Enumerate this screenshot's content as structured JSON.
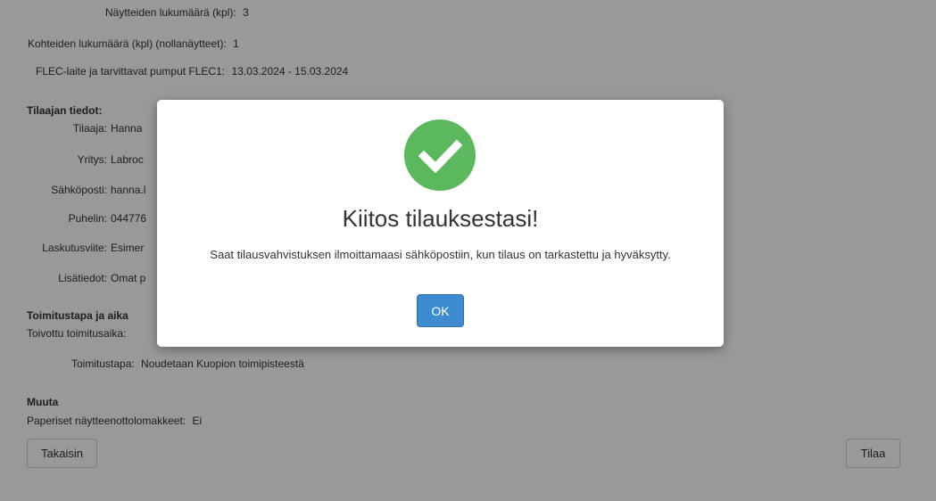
{
  "form": {
    "samples": {
      "label": "Näytteiden lukumäärä (kpl):",
      "value": "3"
    },
    "targets": {
      "label": "Kohteiden lukumäärä (kpl) (nollanäytteet):",
      "value": "1"
    },
    "flec": {
      "label": "FLEC-laite ja tarvittavat pumput FLEC1:",
      "value": "13.03.2024 - 15.03.2024"
    },
    "customer_heading": "Tilaajan tiedot:",
    "customer": [
      {
        "label": "Tilaaja:",
        "value": "Hanna"
      },
      {
        "label": "Yritys:",
        "value": "Labroc"
      },
      {
        "label": "Sähköposti:",
        "value": "hanna.l"
      },
      {
        "label": "Puhelin:",
        "value": "044776"
      },
      {
        "label": "Laskutusviite:",
        "value": "Esimer"
      },
      {
        "label": "Lisätiedot:",
        "value": "Omat p"
      }
    ],
    "delivery_heading": "Toimitustapa ja aika",
    "delivery_time_label": "Toivottu toimitusaika:",
    "delivery_method": {
      "label": "Toimitustapa:",
      "value": "Noudetaan Kuopion toimipisteestä"
    },
    "other_heading": "Muuta",
    "paper_forms": {
      "label": "Paperiset näytteenottolomakkeet:",
      "value": "Ei"
    }
  },
  "buttons": {
    "back": "Takaisin",
    "order": "Tilaa"
  },
  "modal": {
    "icon": "success-check-icon",
    "title": "Kiitos tilauksestasi!",
    "text": "Saat tilausvahvistuksen ilmoittamaasi sähköpostiin, kun tilaus on tarkastettu ja hyväksytty.",
    "ok": "OK",
    "accent": "#5cb85c",
    "button_color": "#3d8bd0"
  }
}
